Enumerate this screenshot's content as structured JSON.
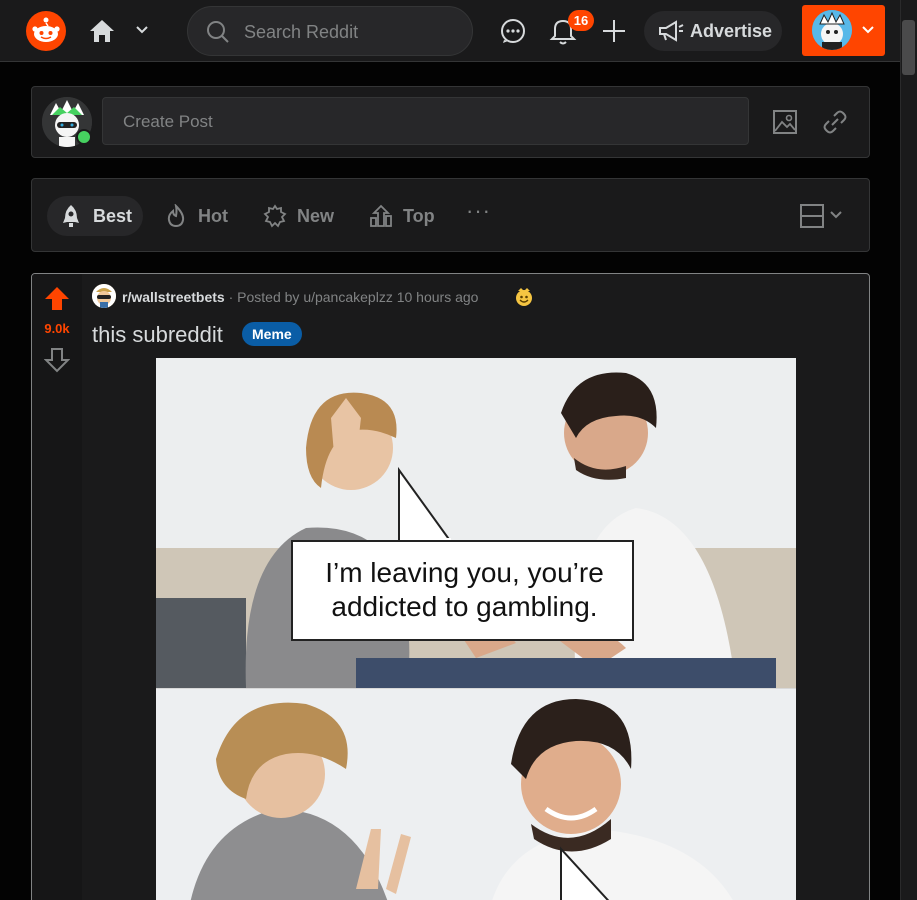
{
  "header": {
    "search_placeholder": "Search Reddit",
    "notification_count": "16",
    "advertise_label": "Advertise"
  },
  "create_post": {
    "placeholder": "Create Post"
  },
  "sort_bar": {
    "options": [
      {
        "label": "Best",
        "active": true
      },
      {
        "label": "Hot"
      },
      {
        "label": "New"
      },
      {
        "label": "Top"
      }
    ],
    "more_label": "···"
  },
  "post": {
    "score": "9.0k",
    "subreddit": "r/wallstreetbets",
    "posted_by": "· Posted by u/pancakeplzz 10 hours ago",
    "title": "this subreddit",
    "flair": "Meme",
    "flair_color": "#0a5da6",
    "image": {
      "caption_top": "I’m leaving you, you’re addicted to gambling."
    }
  },
  "colors": {
    "accent": "#ff4500",
    "background": "#030303",
    "surface": "#1a1a1b"
  }
}
